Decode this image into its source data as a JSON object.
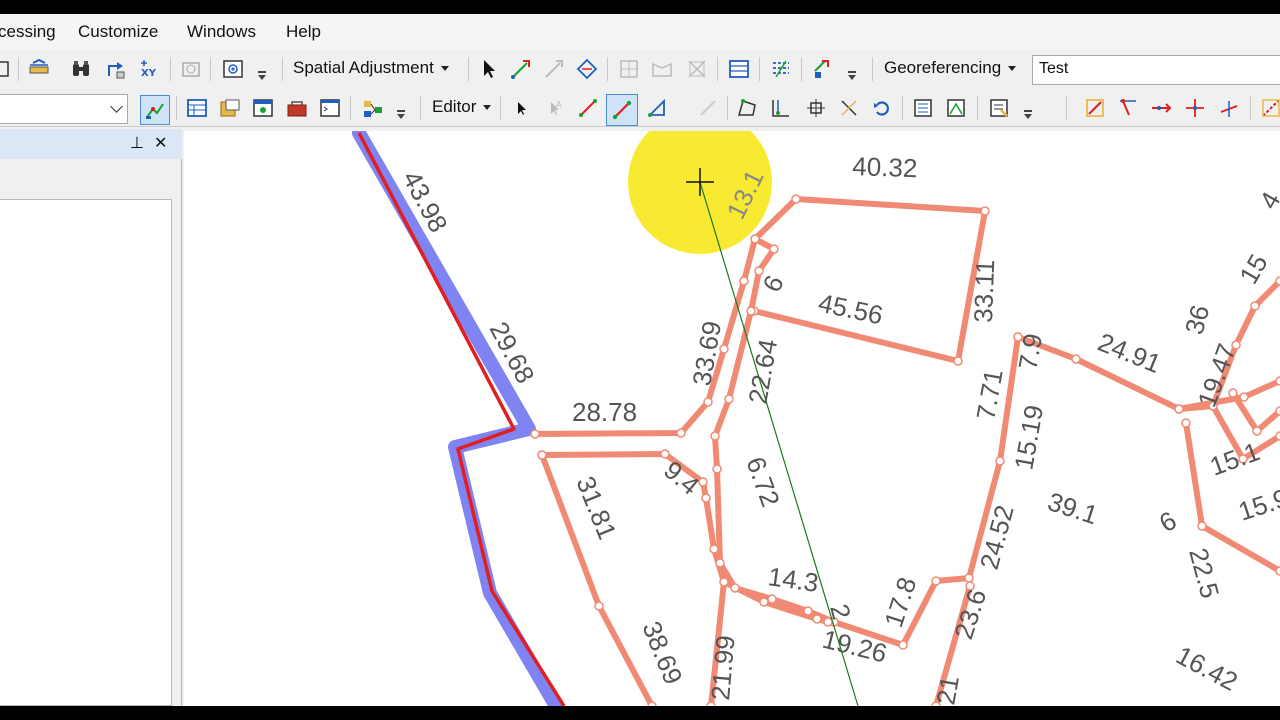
{
  "menu": {
    "geoprocessing": "cessing",
    "customize": "Customize",
    "windows": "Windows",
    "help": "Help"
  },
  "toolbars": {
    "spatial_adjustment": "Spatial Adjustment",
    "georeferencing": "Georeferencing",
    "layer_combo_value": "Test",
    "editor": "Editor"
  },
  "panel": {
    "pin_glyph": "⊥",
    "close_glyph": "✕"
  },
  "map": {
    "cursor": "crosshair-cursor",
    "highlight_color": "#f7e81a",
    "parcel_color": "#f08a75",
    "selected_color": "#e21e1e",
    "selection_halo": "#7f84f2",
    "labels": {
      "l4398": "43.98",
      "l2968": "29.68",
      "l2878": "28.78",
      "l3181": "31.81",
      "l3869": "38.69",
      "l131": "13.1",
      "l4032": "40.32",
      "l6": "6",
      "l3311": "33.11",
      "l4556": "45.56",
      "l3369": "33.69",
      "l2264": "22.64",
      "l94": "9.4",
      "l672": "6.72",
      "l143": "14.3",
      "l2": "2",
      "l2199": "21.99",
      "l1926": "19.26",
      "l178": "17.8",
      "l236": "23.6",
      "l2452": "24.52",
      "l1519": "15.19",
      "l771": "7.71",
      "l79": "7.9",
      "l2491": "24.91",
      "l391": "39.1",
      "l1947": "19.47",
      "l151": "15.1",
      "l159": "15.9",
      "l225": "22.5",
      "l1642": "16.42",
      "l15": "15",
      "l4": "4",
      "l36": "36",
      "l21": "21",
      "l6b": "6"
    }
  }
}
